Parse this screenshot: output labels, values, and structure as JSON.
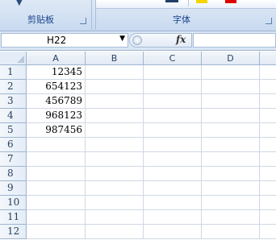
{
  "ribbon": {
    "clipboard_label": "剪贴板",
    "font_label": "字体",
    "paste_icon": "arrow-down-icon",
    "dialog_icon": "dialog-launcher-icon",
    "colors": {
      "highlight": "#f5d400",
      "font_color": "#e00000"
    }
  },
  "formula_bar": {
    "name_box": "H22",
    "fx_label": "fx",
    "formula": ""
  },
  "grid": {
    "columns": [
      "A",
      "B",
      "C",
      "D"
    ],
    "rows": [
      "1",
      "2",
      "3",
      "4",
      "5",
      "6",
      "7",
      "8",
      "9",
      "10",
      "11",
      "12"
    ],
    "cells_A": [
      "12345",
      "654123",
      "456789",
      "968123",
      "987456",
      "",
      "",
      "",
      "",
      "",
      "",
      ""
    ]
  }
}
